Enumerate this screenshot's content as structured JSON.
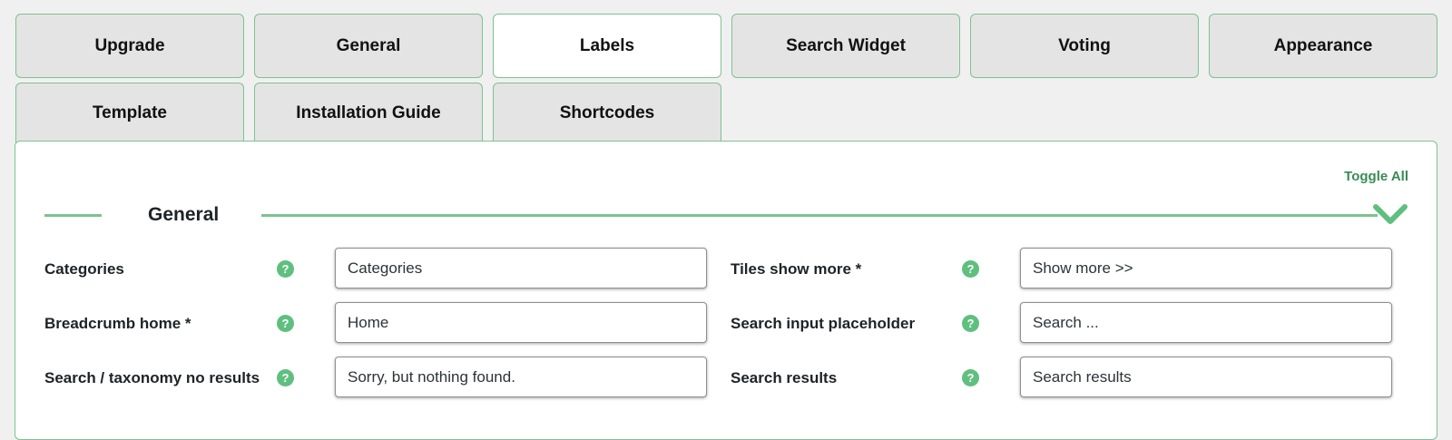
{
  "tabs": [
    {
      "label": "Upgrade"
    },
    {
      "label": "General"
    },
    {
      "label": "Labels"
    },
    {
      "label": "Search Widget"
    },
    {
      "label": "Voting"
    },
    {
      "label": "Appearance"
    },
    {
      "label": "Template"
    },
    {
      "label": "Installation Guide"
    },
    {
      "label": "Shortcodes"
    }
  ],
  "active_tab": "Labels",
  "panel": {
    "toggle_all": "Toggle All",
    "section_title": "General",
    "fields": [
      {
        "label": "Categories",
        "value": "Categories",
        "help": "?"
      },
      {
        "label": "Tiles show more *",
        "value": "Show more >>",
        "help": "?"
      },
      {
        "label": "Breadcrumb home *",
        "value": "Home",
        "help": "?"
      },
      {
        "label": "Search input placeholder",
        "value": "Search ...",
        "help": "?"
      },
      {
        "label": "Search / taxonomy no results",
        "value": "Sorry, but nothing found.",
        "help": "?"
      },
      {
        "label": "Search results",
        "value": "Search results",
        "help": "?"
      }
    ]
  },
  "colors": {
    "accent": "#7cc38f",
    "help_icon": "#5fbf7f",
    "link": "#3a8a56",
    "background": "#f0f0f0"
  },
  "icons": {
    "help": "question-mark-circle-icon",
    "collapse": "chevron-down-icon"
  }
}
